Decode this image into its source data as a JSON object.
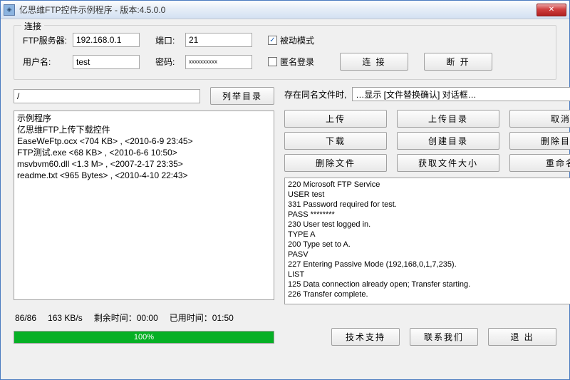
{
  "title": "亿思维FTP控件示例程序 - 版本:4.5.0.0",
  "groupbox": {
    "title": "连接",
    "server_label": "FTP服务器:",
    "server_value": "192.168.0.1",
    "port_label": "端口:",
    "port_value": "21",
    "passive_label": "被动模式",
    "passive_checked": "✓",
    "user_label": "用户名:",
    "user_value": "test",
    "pass_label": "密码:",
    "pass_value": "xxxxxxxxxx",
    "anon_label": "匿名登录",
    "connect_btn": "连 接",
    "disconnect_btn": "断 开"
  },
  "path_value": "/",
  "list_btn": "列举目录",
  "samename_label": "存在同名文件时,",
  "samename_option": "…显示 [文件替换确认] 对话框…",
  "filelist": [
    "示例程序",
    "亿思维FTP上传下载控件",
    "EaseWeFtp.ocx  <704 KB> , <2010-6-9 23:45>",
    "FTP测试.exe  <68 KB> , <2010-6-6 10:50>",
    "msvbvm60.dll  <1.3 M> , <2007-2-17 23:35>",
    "readme.txt  <965 Bytes> , <2010-4-10 22:43>"
  ],
  "actions": {
    "upload": "上传",
    "upload_dir": "上传目录",
    "cancel": "取消",
    "download": "下载",
    "create_dir": "创建目录",
    "delete_dir": "删除目录",
    "delete_file": "删除文件",
    "get_size": "获取文件大小",
    "rename": "重命名"
  },
  "log": [
    "220 Microsoft FTP Service",
    "USER test",
    "331 Password required for test.",
    "PASS ********",
    "230 User test logged in.",
    "TYPE A",
    "200 Type set to A.",
    "PASV",
    "227 Entering Passive Mode (192,168,0,1,7,235).",
    "LIST",
    "125 Data connection already open; Transfer starting.",
    "226 Transfer complete."
  ],
  "status": {
    "count": "86/86",
    "speed": "163 KB/s",
    "remain_label": "剩余时间：",
    "remain_value": "00:00",
    "elapsed_label": "已用时间：",
    "elapsed_value": "01:50"
  },
  "progress": {
    "percent": "100%",
    "width": "100%"
  },
  "footer": {
    "tech": "技术支持",
    "contact": "联系我们",
    "exit": "退 出"
  }
}
